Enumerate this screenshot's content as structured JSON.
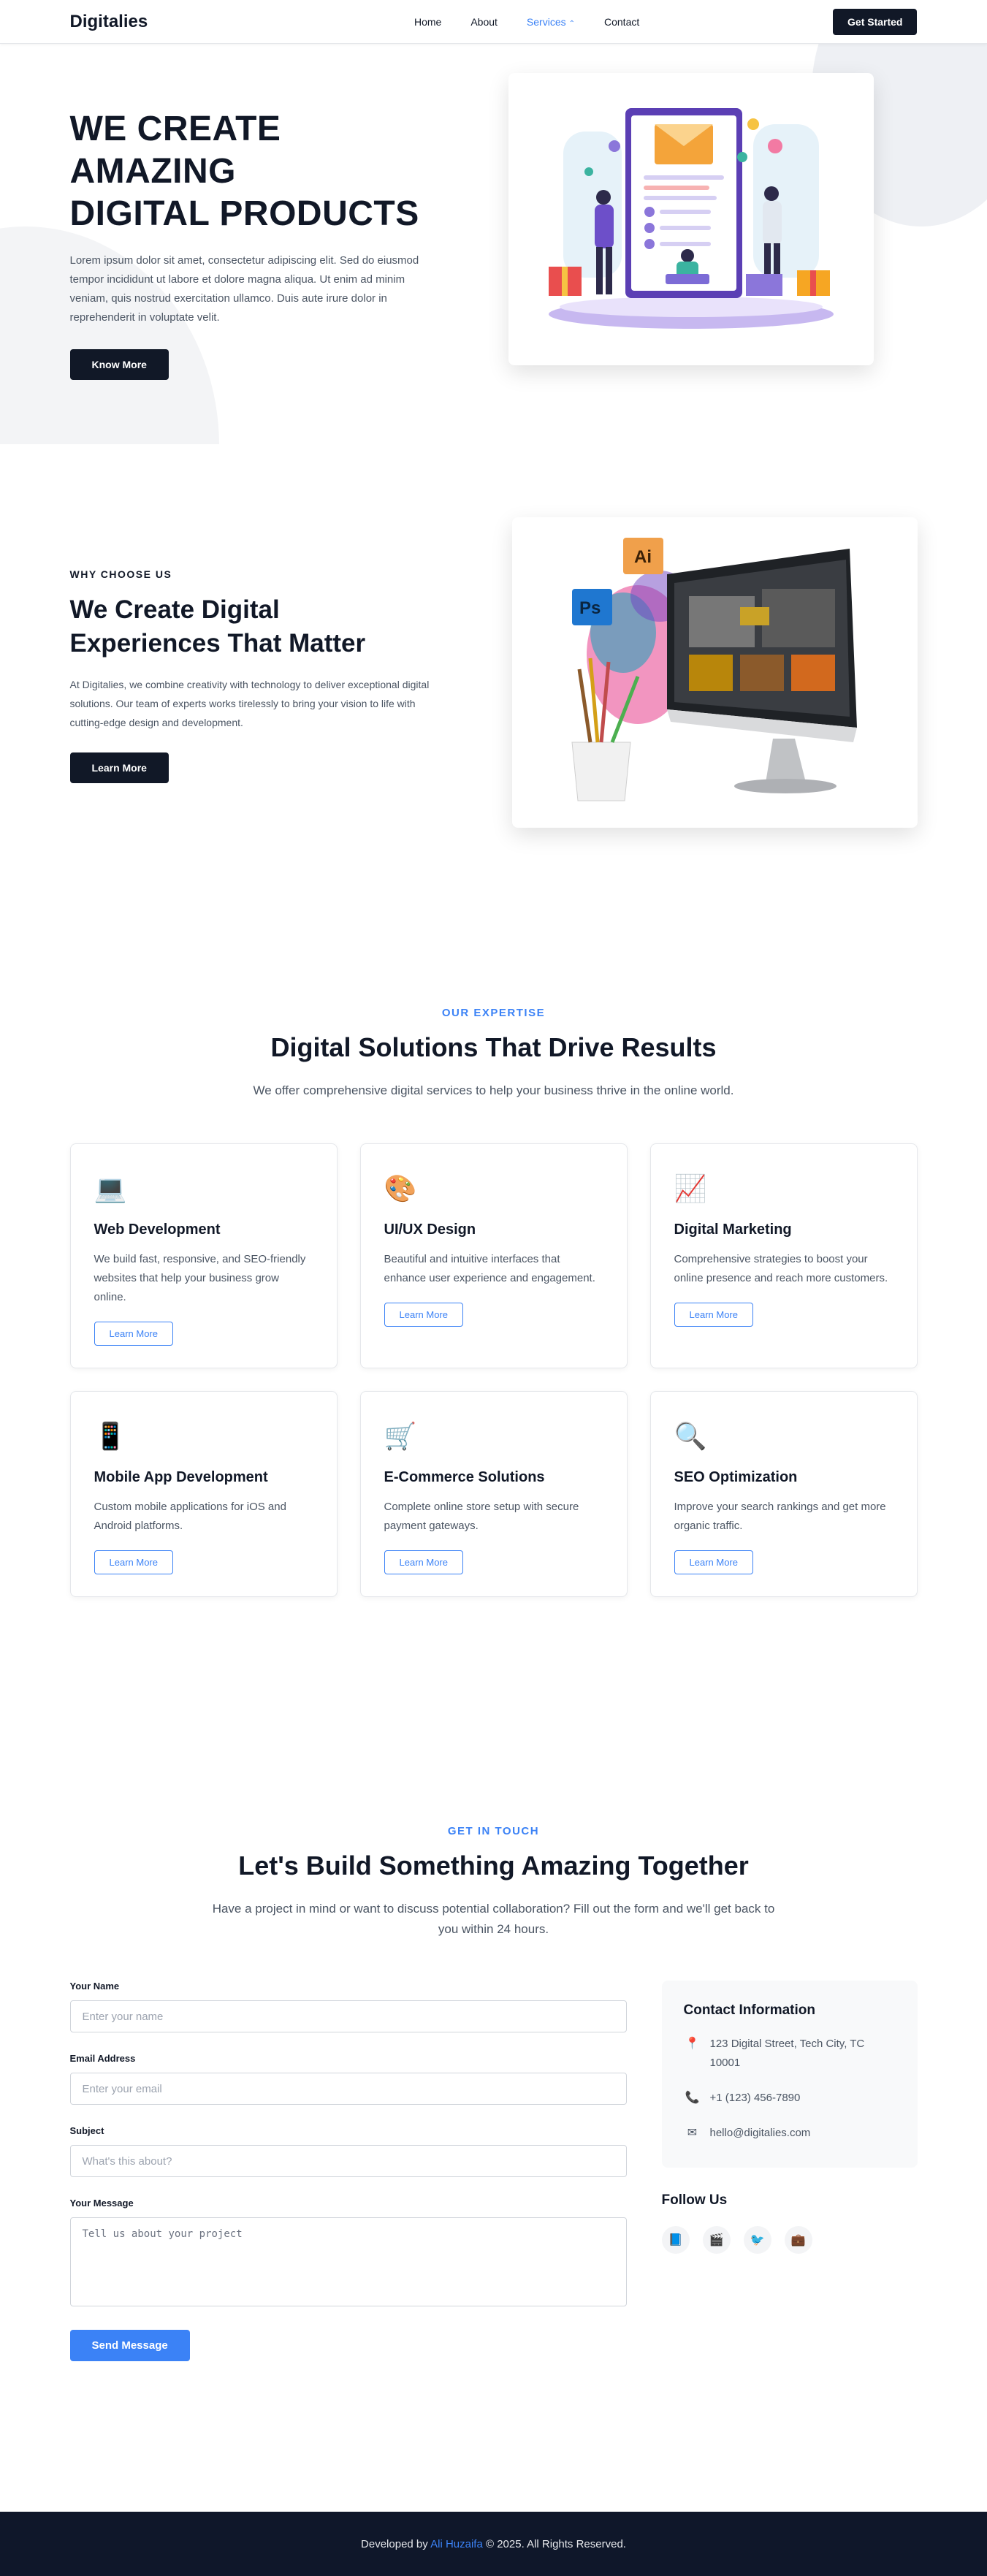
{
  "nav": {
    "logo": "Digitalies",
    "links": [
      "Home",
      "About",
      "Services",
      "Contact"
    ],
    "cta": "Get Started"
  },
  "hero": {
    "title_line1": "WE CREATE AMAZING",
    "title_line2": "DIGITAL PRODUCTS",
    "description": "Lorem ipsum dolor sit amet, consectetur adipiscing elit. Sed do eiusmod tempor incididunt ut labore et dolore magna aliqua. Ut enim ad minim veniam, quis nostrud exercitation ullamco. Duis aute irure dolor in reprehenderit in voluptate velit.",
    "button": "Know More"
  },
  "why": {
    "eyebrow": "WHY CHOOSE US",
    "title": "We Create Digital Experiences That Matter",
    "description": "At Digitalies, we combine creativity with technology to deliver exceptional digital solutions. Our team of experts works tirelessly to bring your vision to life with cutting-edge design and development.",
    "button": "Learn More"
  },
  "services": {
    "eyebrow": "OUR EXPERTISE",
    "title": "Digital Solutions That Drive Results",
    "subtitle": "We offer comprehensive digital services to help your business thrive in the online world.",
    "cards": [
      {
        "icon": "💻",
        "title": "Web Development",
        "desc": "We build fast, responsive, and SEO-friendly websites that help your business grow online.",
        "button": "Learn More"
      },
      {
        "icon": "🎨",
        "title": "UI/UX Design",
        "desc": "Beautiful and intuitive interfaces that enhance user experience and engagement.",
        "button": "Learn More"
      },
      {
        "icon": "📈",
        "title": "Digital Marketing",
        "desc": "Comprehensive strategies to boost your online presence and reach more customers.",
        "button": "Learn More"
      },
      {
        "icon": "📱",
        "title": "Mobile App Development",
        "desc": "Custom mobile applications for iOS and Android platforms.",
        "button": "Learn More"
      },
      {
        "icon": "🛒",
        "title": "E-Commerce Solutions",
        "desc": "Complete online store setup with secure payment gateways.",
        "button": "Learn More"
      },
      {
        "icon": "🔍",
        "title": "SEO Optimization",
        "desc": "Improve your search rankings and get more organic traffic.",
        "button": "Learn More"
      }
    ]
  },
  "contact": {
    "eyebrow": "GET IN TOUCH",
    "title": "Let's Build Something Amazing Together",
    "subtitle": "Have a project in mind or want to discuss potential collaboration? Fill out the form and we'll get back to you within 24 hours.",
    "form": {
      "name_label": "Your Name",
      "name_placeholder": "Enter your name",
      "email_label": "Email Address",
      "email_placeholder": "Enter your email",
      "subject_label": "Subject",
      "subject_placeholder": "What's this about?",
      "message_label": "Your Message",
      "message_placeholder": "Tell us about your project",
      "submit": "Send Message"
    },
    "info": {
      "title": "Contact Information",
      "address": "123 Digital Street, Tech City, TC 10001",
      "phone": "+1 (123) 456-7890",
      "email": "hello@digitalies.com"
    },
    "follow_title": "Follow Us"
  },
  "footer": {
    "prefix": "Developed by ",
    "author": "Ali Huzaifa",
    "suffix": " © 2025. All Rights Reserved."
  },
  "colors": {
    "dark": "#111827",
    "accent": "#3b82f6",
    "footer_bg": "#0f172a"
  }
}
